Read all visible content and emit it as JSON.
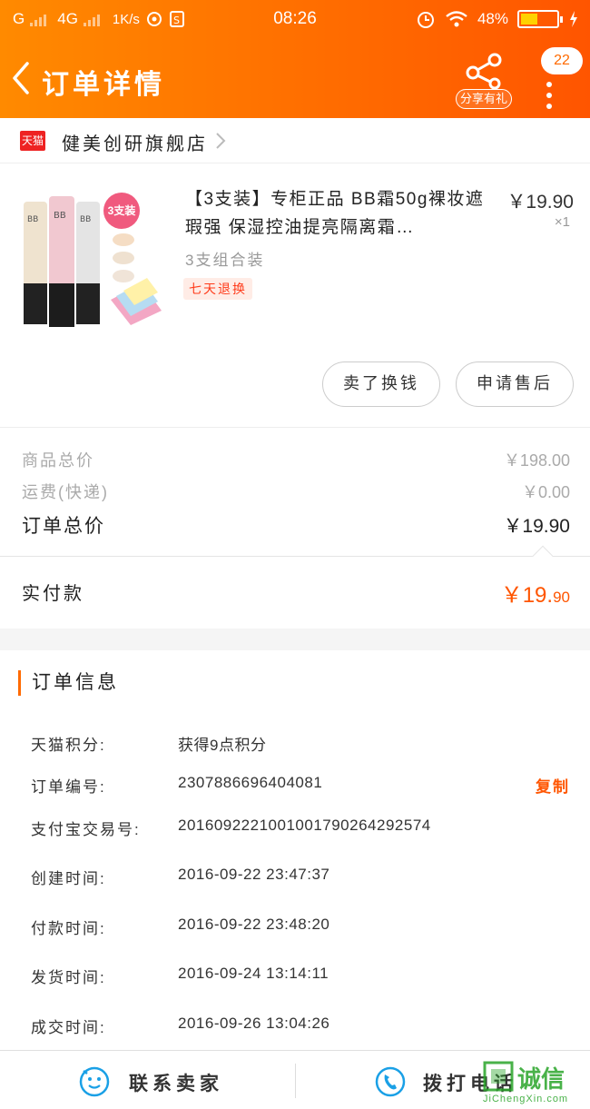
{
  "status_bar": {
    "carrier_g": "G",
    "network": "4G",
    "speed": "1K/s",
    "time": "08:26",
    "battery_pct": "48%",
    "battery_level": 0.48
  },
  "nav": {
    "title": "订单详情",
    "share_label": "分享有礼",
    "badge_count": "22"
  },
  "shop": {
    "logo_text": "天猫",
    "name": "健美创研旗舰店"
  },
  "product": {
    "title": "【3支装】专柜正品 BB霜50g裸妆遮瑕强 保湿控油提亮隔离霜…",
    "price": "￥19.90",
    "qty": "×1",
    "spec": "3支组合装",
    "return_tag": "七天退换",
    "image_badge": "3支装",
    "btn_sell": "卖了换钱",
    "btn_aftersale": "申请售后"
  },
  "prices": {
    "goods_total_label": "商品总价",
    "goods_total": "￥198.00",
    "shipping_label": "运费(快递)",
    "shipping": "￥0.00",
    "order_total_label": "订单总价",
    "order_total": "￥19.90",
    "paid_label": "实付款",
    "paid_main": "￥19.",
    "paid_cents": "90"
  },
  "order_info": {
    "heading": "订单信息",
    "rows": [
      {
        "label": "天猫积分:",
        "value": "获得9点积分"
      },
      {
        "label": "订单编号:",
        "value": "2307886696404081"
      },
      {
        "label": "支付宝交易号:",
        "value": "2016092221001001790264292574"
      },
      {
        "label": "创建时间:",
        "value": "2016-09-22 23:47:37"
      },
      {
        "label": "付款时间:",
        "value": "2016-09-22 23:48:20"
      },
      {
        "label": "发货时间:",
        "value": "2016-09-24 13:14:11"
      },
      {
        "label": "成交时间:",
        "value": "2016-09-26 13:04:26"
      }
    ],
    "copy_label": "复制"
  },
  "bottom_bar": {
    "contact_seller": "联系卖家",
    "call": "拨打电话"
  },
  "watermark": {
    "text": "诚信",
    "sub": "JiChengXin.com"
  },
  "colors": {
    "accent": "#ff6a00",
    "price_red": "#ff5500",
    "icon_blue": "#1aa0e6"
  }
}
